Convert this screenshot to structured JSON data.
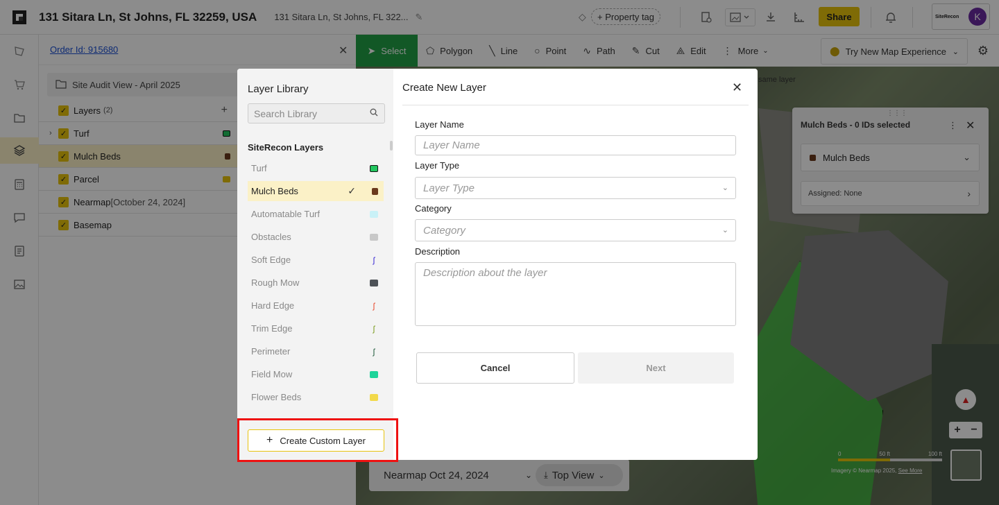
{
  "header": {
    "title": "131 Sitara Ln, St Johns, FL 32259, USA",
    "subtitle": "131 Sitara Ln, St Johns, FL 322...",
    "property_tag": "+ Property tag",
    "share": "Share",
    "brand": "SiteRecon",
    "avatar_initial": "K"
  },
  "panel": {
    "order_link": "Order Id: 915680",
    "view_name": "Site Audit View - April 2025",
    "layers_label": "Layers",
    "layers_count": "(2)",
    "layers": [
      {
        "name": "Turf",
        "color": "#22c55e"
      },
      {
        "name": "Mulch Beds",
        "color": "#6b3a1d"
      },
      {
        "name": "Parcel",
        "color": "#e8c30c"
      },
      {
        "name": "Nearmap",
        "meta": "[October 24, 2024]"
      },
      {
        "name": "Basemap"
      }
    ]
  },
  "toolbar": {
    "tools": [
      "Select",
      "Polygon",
      "Line",
      "Point",
      "Path",
      "Cut",
      "Edit",
      "More"
    ],
    "try_map": "Try New Map Experience"
  },
  "map": {
    "hint": "same layer",
    "card": {
      "title": "Mulch Beds - 0 IDs selected",
      "dropdown": "Mulch Beds",
      "assigned": "Assigned: None"
    },
    "scale": [
      "0",
      "50 ft",
      "100 ft"
    ],
    "imagery": "Imagery © Nearmap 2025,",
    "see_more": "See More",
    "date": "Nearmap Oct 24, 2024",
    "view": "Top View"
  },
  "library": {
    "title": "Layer Library",
    "search_placeholder": "Search Library",
    "section": "SiteRecon Layers",
    "items": [
      {
        "name": "Turf",
        "color": "#22c55e",
        "icon": "fill"
      },
      {
        "name": "Mulch Beds",
        "color": "#6b3a1d",
        "icon": "fill",
        "selected": true
      },
      {
        "name": "Automatable Turf",
        "color": "#c9f1f7",
        "icon": "fill"
      },
      {
        "name": "Obstacles",
        "color": "#c8c8c8",
        "icon": "fill"
      },
      {
        "name": "Soft Edge",
        "color": "#3a2ad4",
        "icon": "line"
      },
      {
        "name": "Rough Mow",
        "color": "#4d5257",
        "icon": "fill"
      },
      {
        "name": "Hard Edge",
        "color": "#e8492c",
        "icon": "line"
      },
      {
        "name": "Trim Edge",
        "color": "#7a9a1c",
        "icon": "line"
      },
      {
        "name": "Perimeter",
        "color": "#1e5a3a",
        "icon": "line"
      },
      {
        "name": "Field Mow",
        "color": "#1ed49a",
        "icon": "fill"
      },
      {
        "name": "Flower Beds",
        "color": "#f2d94a",
        "icon": "fill"
      }
    ],
    "create_label": "Create Custom Layer"
  },
  "form": {
    "title": "Create New Layer",
    "name_label": "Layer Name",
    "name_placeholder": "Layer Name",
    "type_label": "Layer Type",
    "type_placeholder": "Layer Type",
    "category_label": "Category",
    "category_placeholder": "Category",
    "description_label": "Description",
    "description_placeholder": "Description about the layer",
    "cancel": "Cancel",
    "next": "Next"
  }
}
